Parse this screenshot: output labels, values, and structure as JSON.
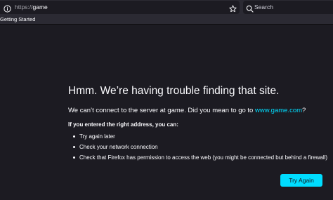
{
  "toolbar": {
    "url_scheme": "https://",
    "url_host": "game",
    "search_placeholder": "Search"
  },
  "bookmarks": {
    "items": [
      {
        "label": "Getting Started"
      }
    ]
  },
  "error_page": {
    "title": "Hmm. We’re having trouble finding that site.",
    "description_prefix": "We can’t connect to the server at game. Did you mean to go to ",
    "suggestion_link": "www.game.com",
    "description_suffix": "?",
    "subheading": "If you entered the right address, you can:",
    "suggestions": [
      "Try again later",
      "Check your network connection",
      "Check that Firefox has permission to access the web (you might be connected but behind a firewall)"
    ],
    "try_again_label": "Try Again"
  },
  "colors": {
    "page_background": "#1c1b22",
    "toolbar_background": "#2b2a33",
    "accent": "#00ddff",
    "text": "#fbfbfe"
  },
  "icons": [
    "info-icon",
    "star-icon",
    "search-icon"
  ]
}
